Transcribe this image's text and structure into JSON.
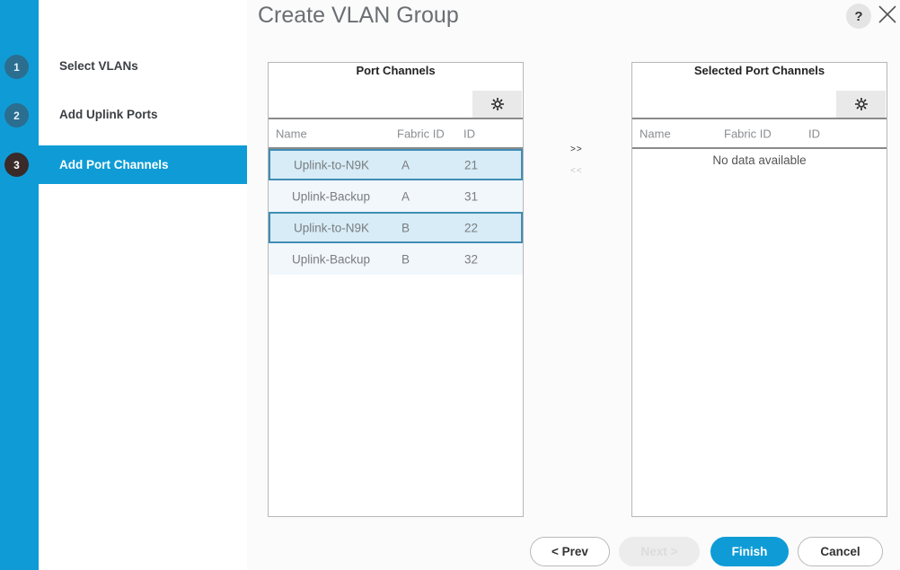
{
  "dialog": {
    "title": "Create VLAN Group",
    "help_label": "?"
  },
  "wizard": {
    "steps": [
      {
        "number": "1",
        "label": "Select VLANs",
        "active": false
      },
      {
        "number": "2",
        "label": "Add Uplink Ports",
        "active": false
      },
      {
        "number": "3",
        "label": "Add Port Channels",
        "active": true
      }
    ]
  },
  "available": {
    "title": "Port Channels",
    "columns": [
      "Name",
      "Fabric ID",
      "ID"
    ],
    "rows": [
      {
        "name": "Uplink-to-N9K",
        "fabric_id": "A",
        "id": "21",
        "selected": true
      },
      {
        "name": "Uplink-Backup",
        "fabric_id": "A",
        "id": "31",
        "selected": false
      },
      {
        "name": "Uplink-to-N9K",
        "fabric_id": "B",
        "id": "22",
        "selected": true
      },
      {
        "name": "Uplink-Backup",
        "fabric_id": "B",
        "id": "32",
        "selected": false
      }
    ]
  },
  "transfer": {
    "add_label": ">>",
    "remove_label": "<<"
  },
  "selected": {
    "title": "Selected Port Channels",
    "columns": [
      "Name",
      "Fabric ID",
      "ID"
    ],
    "empty_text": "No data available"
  },
  "footer": {
    "prev_label": "< Prev",
    "next_label": "Next >",
    "finish_label": "Finish",
    "cancel_label": "Cancel"
  },
  "colors": {
    "accent": "#0f9cd6",
    "selected_row": "#d7ecf6",
    "selected_border": "#3f8db5"
  }
}
